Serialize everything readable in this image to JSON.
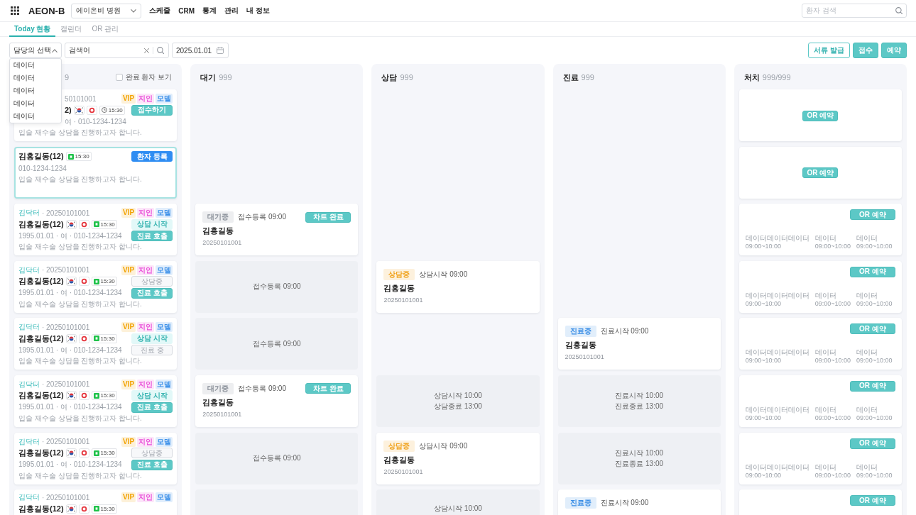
{
  "header": {
    "logo": "AEON-B",
    "hospital_select": {
      "value": "에이온비 병원"
    },
    "nav": [
      "스케줄",
      "CRM",
      "통계",
      "관리",
      "내 정보"
    ],
    "search": {
      "placeholder": "환자 검색"
    }
  },
  "tabs": [
    {
      "label": "Today 현황",
      "selected": true
    },
    {
      "label": "캘린더",
      "selected": false
    },
    {
      "label": "OR 관리",
      "selected": false
    }
  ],
  "toolbar": {
    "doctor_select": {
      "label": "담당의 선택",
      "expanded": true,
      "options": [
        "데이터",
        "데이터",
        "데이터",
        "데이터",
        "데이터"
      ]
    },
    "search": {
      "value": "검색어"
    },
    "date": {
      "value": "2025.01.01"
    },
    "buttons": [
      {
        "label": "서류 발급",
        "kind": "outline"
      },
      {
        "label": "접수",
        "kind": "solid"
      },
      {
        "label": "예약",
        "kind": "solid"
      }
    ]
  },
  "board": {
    "columns": [
      {
        "count": "9",
        "show_completed": {
          "label": "완료 환자 보기",
          "checked": false
        },
        "items": [
          {
            "kind": "patient",
            "selected": false,
            "chart_no": "50101001",
            "tags": [
              {
                "text": "VIP",
                "color": "#f2a200"
              },
              {
                "text": "지인",
                "color": "#e94fd8"
              },
              {
                "text": "모델",
                "color": "#3a8fe8"
              }
            ],
            "name": "2)",
            "flag_icon": true,
            "ring_icon": true,
            "time_chip": {
              "kind": "clock",
              "text": "15:30"
            },
            "info": "여 · 010-1234-1234",
            "memo": "입술 재수술 상담을 진행하고자 합니다.",
            "buttons": [
              {
                "label": "접수하기",
                "kind": "solid"
              }
            ]
          },
          {
            "kind": "patient",
            "selected": true,
            "name": "김홍길동(12)",
            "time_chip": {
              "kind": "channel",
              "text": "15:30"
            },
            "info": "010-1234-1234",
            "memo": "입술 재수술 상담을 진행하고자 합니다.",
            "buttons": [
              {
                "label": "환자 등록",
                "kind": "accent"
              }
            ]
          },
          {
            "kind": "patient",
            "selected": false,
            "doctor": "김닥터",
            "chart_no": "· 20250101001",
            "tags": [
              {
                "text": "VIP",
                "color": "#f2a200"
              },
              {
                "text": "지인",
                "color": "#e94fd8"
              },
              {
                "text": "모델",
                "color": "#3a8fe8"
              }
            ],
            "name": "김홍길동(12)",
            "flag_icon": true,
            "ring_icon": true,
            "time_chip": {
              "kind": "channel",
              "text": "15:30"
            },
            "info": "1995.01.01 · 여 · 010-1234-1234",
            "memo": "입술 재수술 상담을 진행하고자 합니다.",
            "buttons": [
              {
                "label": "상담 시작",
                "kind": "soft"
              },
              {
                "label": "진료 호출",
                "kind": "solid"
              }
            ]
          },
          {
            "kind": "patient",
            "selected": false,
            "doctor": "김닥터",
            "chart_no": "· 20250101001",
            "tags": [
              {
                "text": "VIP",
                "color": "#f2a200"
              },
              {
                "text": "지인",
                "color": "#e94fd8"
              },
              {
                "text": "모델",
                "color": "#3a8fe8"
              }
            ],
            "name": "김홍길동(12)",
            "flag_icon": true,
            "ring_icon": true,
            "time_chip": {
              "kind": "channel",
              "text": "15:30"
            },
            "info": "1995.01.01 · 여 · 010-1234-1234",
            "memo": "입술 재수술 상담을 진행하고자 합니다.",
            "buttons": [
              {
                "label": "상담중",
                "kind": "muted"
              },
              {
                "label": "진료 호출",
                "kind": "solid"
              }
            ]
          },
          {
            "kind": "patient",
            "selected": false,
            "doctor": "김닥터",
            "chart_no": "· 20250101001",
            "tags": [
              {
                "text": "VIP",
                "color": "#f2a200"
              },
              {
                "text": "지인",
                "color": "#e94fd8"
              },
              {
                "text": "모델",
                "color": "#3a8fe8"
              }
            ],
            "name": "김홍길동(12)",
            "flag_icon": true,
            "ring_icon": true,
            "time_chip": {
              "kind": "channel",
              "text": "15:30"
            },
            "info": "1995.01.01 · 여 · 010-1234-1234",
            "memo": "입술 재수술 상담을 진행하고자 합니다.",
            "buttons": [
              {
                "label": "상담 시작",
                "kind": "soft"
              },
              {
                "label": "진료 중",
                "kind": "muted"
              }
            ]
          },
          {
            "kind": "patient",
            "selected": false,
            "doctor": "김닥터",
            "chart_no": "· 20250101001",
            "tags": [
              {
                "text": "VIP",
                "color": "#f2a200"
              },
              {
                "text": "지인",
                "color": "#e94fd8"
              },
              {
                "text": "모델",
                "color": "#3a8fe8"
              }
            ],
            "name": "김홍길동(12)",
            "flag_icon": true,
            "ring_icon": true,
            "time_chip": {
              "kind": "channel",
              "text": "15:30"
            },
            "info": "1995.01.01 · 여 · 010-1234-1234",
            "memo": "입술 재수술 상담을 진행하고자 합니다.",
            "buttons": [
              {
                "label": "상담 시작",
                "kind": "soft"
              },
              {
                "label": "진료 호출",
                "kind": "solid"
              }
            ]
          },
          {
            "kind": "patient",
            "selected": false,
            "doctor": "김닥터",
            "chart_no": "· 20250101001",
            "tags": [
              {
                "text": "VIP",
                "color": "#f2a200"
              },
              {
                "text": "지인",
                "color": "#e94fd8"
              },
              {
                "text": "모델",
                "color": "#3a8fe8"
              }
            ],
            "name": "김홍길동(12)",
            "flag_icon": true,
            "ring_icon": true,
            "time_chip": {
              "kind": "channel",
              "text": "15:30"
            },
            "info": "1995.01.01 · 여 · 010-1234-1234",
            "memo": "입술 재수술 상담을 진행하고자 합니다.",
            "buttons": [
              {
                "label": "상담중",
                "kind": "muted"
              },
              {
                "label": "진료 호출",
                "kind": "solid"
              }
            ]
          },
          {
            "kind": "patient",
            "selected": false,
            "doctor": "김닥터",
            "chart_no": "· 20250101001",
            "tags": [
              {
                "text": "VIP",
                "color": "#f2a200"
              },
              {
                "text": "지인",
                "color": "#e94fd8"
              },
              {
                "text": "모델",
                "color": "#3a8fe8"
              }
            ],
            "name": "김홍길동(12)",
            "flag_icon": true,
            "ring_icon": true,
            "time_chip": {
              "kind": "channel",
              "text": "15:30"
            }
          }
        ]
      },
      {
        "title": "대기",
        "count": "999",
        "items": [
          {
            "kind": "gap"
          },
          {
            "kind": "gap"
          },
          {
            "kind": "visit",
            "status": {
              "text": "대기중",
              "color": "#8a9099"
            },
            "time": "접수등록 09:00",
            "button": {
              "label": "차트 완료",
              "kind": "solid"
            },
            "name": "김홍길동",
            "chart_no": "20250101001"
          },
          {
            "kind": "slot",
            "lines": [
              "접수등록 09:00"
            ]
          },
          {
            "kind": "slot",
            "lines": [
              "접수등록 09:00"
            ]
          },
          {
            "kind": "visit",
            "status": {
              "text": "대기중",
              "color": "#8a9099"
            },
            "time": "접수등록 09:00",
            "button": {
              "label": "차트 완료",
              "kind": "solid"
            },
            "name": "김홍길동",
            "chart_no": "20250101001"
          },
          {
            "kind": "slot",
            "lines": [
              "접수등록 09:00"
            ]
          },
          {
            "kind": "slot"
          }
        ]
      },
      {
        "title": "상담",
        "count": "999",
        "items": [
          {
            "kind": "gap"
          },
          {
            "kind": "gap"
          },
          {
            "kind": "gap"
          },
          {
            "kind": "visit",
            "status": {
              "text": "상담중",
              "color": "#f0a21c"
            },
            "time": "상담시작 09:00",
            "name": "김홍길동",
            "chart_no": "20250101001"
          },
          {
            "kind": "gap"
          },
          {
            "kind": "slot",
            "lines": [
              "상담시작 10:00",
              "상담종료 13:00"
            ]
          },
          {
            "kind": "visit",
            "status": {
              "text": "상담중",
              "color": "#f0a21c"
            },
            "time": "상담시작 09:00",
            "name": "김홍길동",
            "chart_no": "20250101001"
          },
          {
            "kind": "slot",
            "lines": [
              "상담시작 10:00"
            ]
          }
        ]
      },
      {
        "title": "진료",
        "count": "999",
        "items": [
          {
            "kind": "gap"
          },
          {
            "kind": "gap"
          },
          {
            "kind": "gap"
          },
          {
            "kind": "gap"
          },
          {
            "kind": "visit",
            "status": {
              "text": "진료중",
              "color": "#3a8ee6"
            },
            "time": "진료시작 09:00",
            "name": "김홍길동",
            "chart_no": "20250101001"
          },
          {
            "kind": "slot",
            "lines": [
              "진료시작 10:00",
              "진료종료 13:00"
            ]
          },
          {
            "kind": "slot",
            "lines": [
              "진료시작 10:00",
              "진료종료 13:00"
            ]
          },
          {
            "kind": "visit",
            "status": {
              "text": "진료중",
              "color": "#3a8ee6"
            },
            "time": "진료시작 09:00"
          }
        ]
      },
      {
        "title": "처치",
        "count": "999/999",
        "items": [
          {
            "kind": "or_request",
            "button": {
              "label": "OR 예약",
              "kind": "solid"
            }
          },
          {
            "kind": "or_request",
            "button": {
              "label": "OR 예약",
              "kind": "solid"
            }
          },
          {
            "kind": "or_booked",
            "button": {
              "label": "OR 예약",
              "kind": "solid"
            },
            "entries": [
              {
                "title": "데이터데이터데이터",
                "time": "09:00~10:00"
              },
              {
                "title": "데이터",
                "time": "09:00~10:00"
              },
              {
                "title": "데이터",
                "time": "09:00~10:00"
              }
            ]
          },
          {
            "kind": "or_booked",
            "button": {
              "label": "OR 예약",
              "kind": "solid"
            },
            "entries": [
              {
                "title": "데이터데이터데이터",
                "time": "09:00~10:00"
              },
              {
                "title": "데이터",
                "time": "09:00~10:00"
              },
              {
                "title": "데이터",
                "time": "09:00~10:00"
              }
            ]
          },
          {
            "kind": "or_booked",
            "button": {
              "label": "OR 예약",
              "kind": "solid"
            },
            "entries": [
              {
                "title": "데이터데이터데이터",
                "time": "09:00~10:00"
              },
              {
                "title": "데이터",
                "time": "09:00~10:00"
              },
              {
                "title": "데이터",
                "time": "09:00~10:00"
              }
            ]
          },
          {
            "kind": "or_booked",
            "button": {
              "label": "OR 예약",
              "kind": "solid"
            },
            "entries": [
              {
                "title": "데이터데이터데이터",
                "time": "09:00~10:00"
              },
              {
                "title": "데이터",
                "time": "09:00~10:00"
              },
              {
                "title": "데이터",
                "time": "09:00~10:00"
              }
            ]
          },
          {
            "kind": "or_booked",
            "button": {
              "label": "OR 예약",
              "kind": "solid"
            },
            "entries": [
              {
                "title": "데이터데이터데이터",
                "time": "09:00~10:00"
              },
              {
                "title": "데이터",
                "time": "09:00~10:00"
              },
              {
                "title": "데이터",
                "time": "09:00~10:00"
              }
            ]
          },
          {
            "kind": "or_booked",
            "button": {
              "label": "OR 예약",
              "kind": "solid"
            }
          }
        ]
      }
    ]
  }
}
